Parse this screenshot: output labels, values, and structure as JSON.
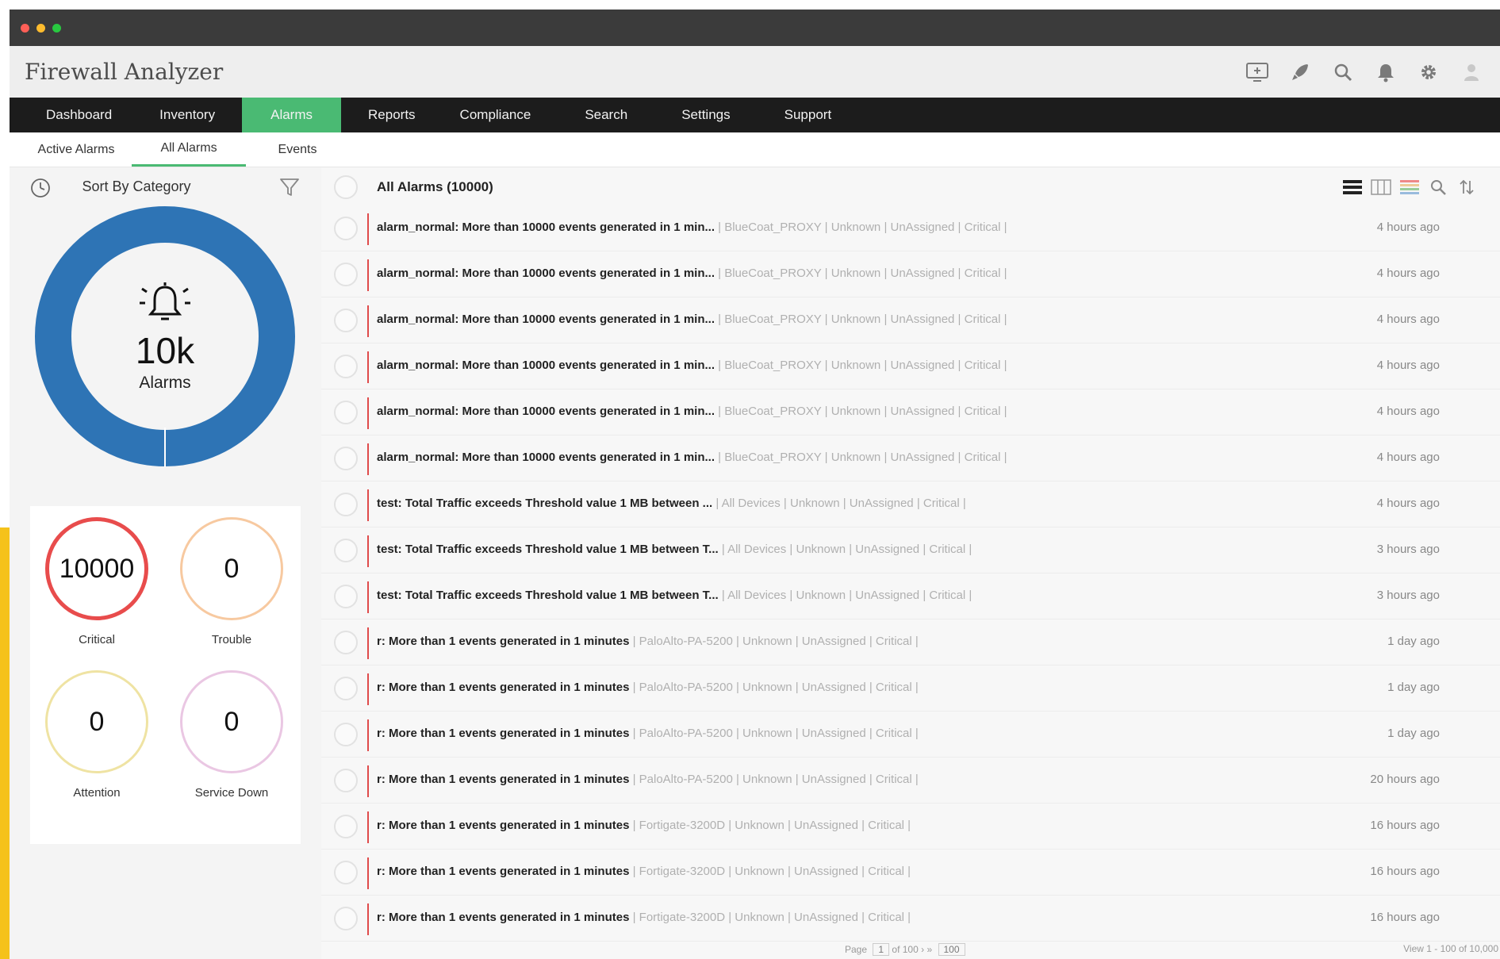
{
  "app": {
    "title": "Firewall Analyzer"
  },
  "window_controls": {
    "colors": [
      "#ff5f57",
      "#febc2e",
      "#28c840"
    ]
  },
  "header_icons": [
    "monitor-icon",
    "rocket-icon",
    "search-icon",
    "bell-icon",
    "gear-icon",
    "user-icon"
  ],
  "nav": {
    "items": [
      "Dashboard",
      "Inventory",
      "Alarms",
      "Reports",
      "Compliance",
      "Search",
      "Settings",
      "Support"
    ],
    "active": "Alarms"
  },
  "subnav": {
    "items": [
      "Active Alarms",
      "All Alarms",
      "Events"
    ],
    "active": "All Alarms"
  },
  "sidebar": {
    "sort_label": "Sort By Category",
    "donut": {
      "count": "10k",
      "label": "Alarms",
      "color": "#2e74b5"
    },
    "categories": [
      {
        "value": "10000",
        "label": "Critical",
        "color": "#e84c4c"
      },
      {
        "value": "0",
        "label": "Trouble",
        "color": "#f7c9a0"
      },
      {
        "value": "0",
        "label": "Attention",
        "color": "#efe3a3"
      },
      {
        "value": "0",
        "label": "Service Down",
        "color": "#eac7e3"
      }
    ]
  },
  "list": {
    "title": "All Alarms (10000)",
    "rows": [
      {
        "msg": "alarm_normal: More than 10000 events generated in 1 min...",
        "meta": "| BlueCoat_PROXY | Unknown | UnAssigned | Critical |",
        "time": "4 hours ago"
      },
      {
        "msg": "alarm_normal: More than 10000 events generated in 1 min...",
        "meta": "| BlueCoat_PROXY | Unknown | UnAssigned | Critical |",
        "time": "4 hours ago"
      },
      {
        "msg": "alarm_normal: More than 10000 events generated in 1 min...",
        "meta": "| BlueCoat_PROXY | Unknown | UnAssigned | Critical |",
        "time": "4 hours ago"
      },
      {
        "msg": "alarm_normal: More than 10000 events generated in 1 min...",
        "meta": "| BlueCoat_PROXY | Unknown | UnAssigned | Critical |",
        "time": "4 hours ago"
      },
      {
        "msg": "alarm_normal: More than 10000 events generated in 1 min...",
        "meta": "| BlueCoat_PROXY | Unknown | UnAssigned | Critical |",
        "time": "4 hours ago"
      },
      {
        "msg": "alarm_normal: More than 10000 events generated in 1 min...",
        "meta": "| BlueCoat_PROXY | Unknown | UnAssigned | Critical |",
        "time": "4 hours ago"
      },
      {
        "msg": "test: Total Traffic exceeds Threshold value 1 MB between ...",
        "meta": "| All Devices | Unknown | UnAssigned | Critical |",
        "time": "4 hours ago"
      },
      {
        "msg": "test: Total Traffic exceeds Threshold value 1 MB between T...",
        "meta": "| All Devices | Unknown | UnAssigned | Critical |",
        "time": "3 hours ago"
      },
      {
        "msg": "test: Total Traffic exceeds Threshold value 1 MB between T...",
        "meta": "| All Devices | Unknown | UnAssigned | Critical |",
        "time": "3 hours ago"
      },
      {
        "msg": "r: More than 1 events generated in 1 minutes",
        "meta": "| PaloAlto-PA-5200 | Unknown | UnAssigned | Critical |",
        "time": "1 day ago"
      },
      {
        "msg": "r: More than 1 events generated in 1 minutes",
        "meta": "| PaloAlto-PA-5200 | Unknown | UnAssigned | Critical |",
        "time": "1 day ago"
      },
      {
        "msg": "r: More than 1 events generated in 1 minutes",
        "meta": "| PaloAlto-PA-5200 | Unknown | UnAssigned | Critical |",
        "time": "1 day ago"
      },
      {
        "msg": "r: More than 1 events generated in 1 minutes",
        "meta": "| PaloAlto-PA-5200 | Unknown | UnAssigned | Critical |",
        "time": "20 hours ago"
      },
      {
        "msg": "r: More than 1 events generated in 1 minutes",
        "meta": "| Fortigate-3200D | Unknown | UnAssigned | Critical |",
        "time": "16 hours ago"
      },
      {
        "msg": "r: More than 1 events generated in 1 minutes",
        "meta": "| Fortigate-3200D | Unknown | UnAssigned | Critical |",
        "time": "16 hours ago"
      },
      {
        "msg": "r: More than 1 events generated in 1 minutes",
        "meta": "| Fortigate-3200D | Unknown | UnAssigned | Critical |",
        "time": "16 hours ago"
      }
    ]
  },
  "pager": {
    "page_label": "Page",
    "of_label": "of 100",
    "per_page": "100",
    "view_info": "View 1 - 100 of 10,000"
  }
}
